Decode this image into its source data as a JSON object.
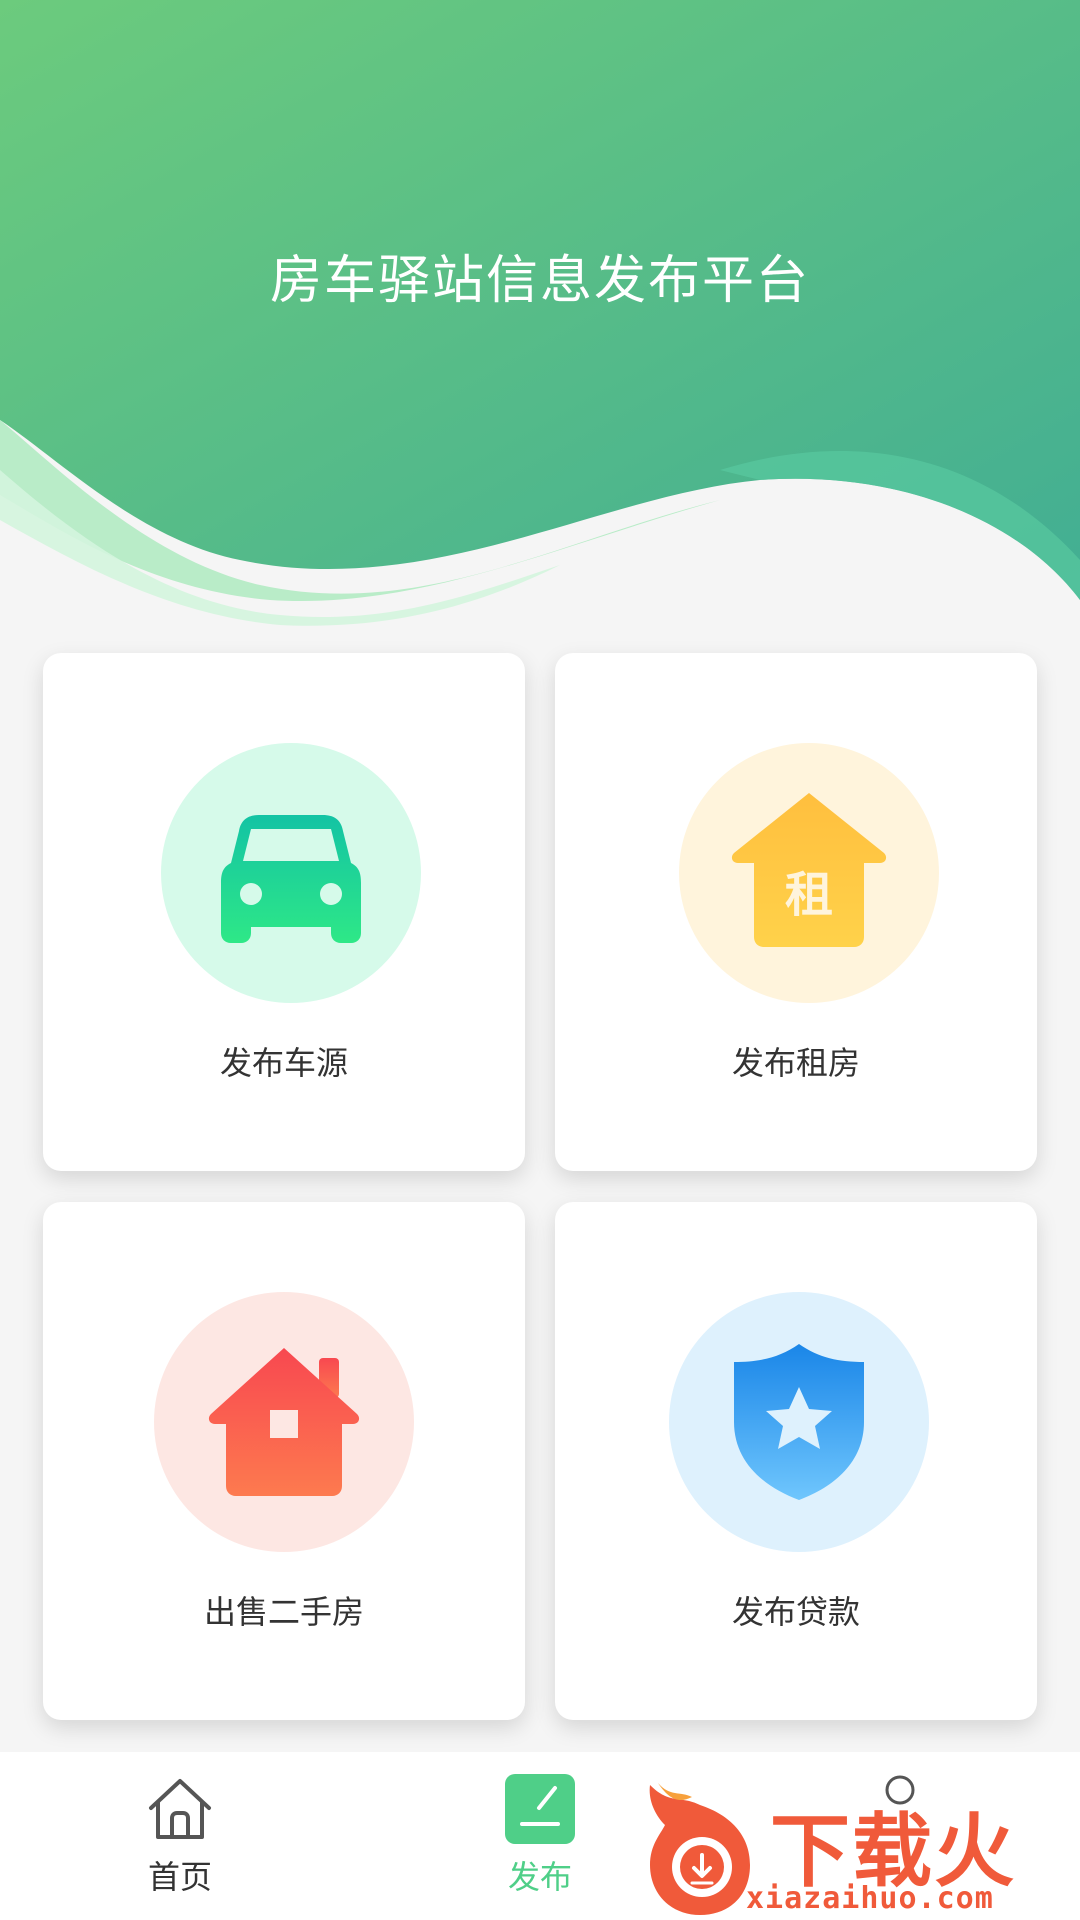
{
  "header": {
    "title": "房车驿站信息发布平台",
    "colors": {
      "gradient_start": "#6ccb7d",
      "gradient_end": "#42ae93",
      "wave_light": "#c8f0d4"
    }
  },
  "cards": [
    {
      "label": "发布车源",
      "icon": "car-icon",
      "circle_color": "#d6faea",
      "icon_color": "#1fd28c"
    },
    {
      "label": "发布租房",
      "icon": "rent-house-icon",
      "icon_text": "租",
      "circle_color": "#fff4dc",
      "icon_color": "#ffc23e"
    },
    {
      "label": "出售二手房",
      "icon": "house-icon",
      "circle_color": "#fde7e3",
      "icon_color": "#f8544e"
    },
    {
      "label": "发布贷款",
      "icon": "shield-star-icon",
      "circle_color": "#def1fd",
      "icon_color": "#1a86e8"
    }
  ],
  "tabbar": {
    "home_label": "首页",
    "publish_label": "发布",
    "active_color": "#4fcf88"
  },
  "watermark": {
    "text": "下载火",
    "url": "xiazaihuo.com"
  }
}
